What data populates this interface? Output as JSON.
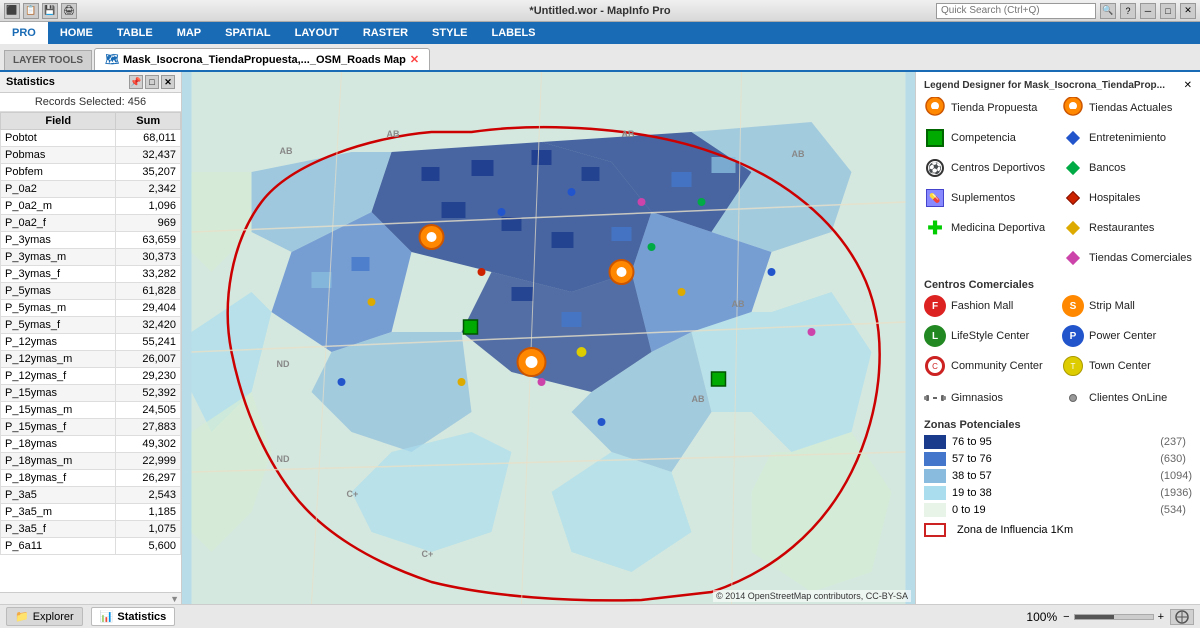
{
  "titlebar": {
    "title": "*Untitled.wor - MapInfo Pro",
    "search_placeholder": "Quick Search (Ctrl+Q)"
  },
  "menubar": {
    "items": [
      {
        "label": "PRO",
        "active": true
      },
      {
        "label": "HOME"
      },
      {
        "label": "TABLE"
      },
      {
        "label": "MAP"
      },
      {
        "label": "SPATIAL"
      },
      {
        "label": "LAYOUT"
      },
      {
        "label": "RASTER"
      },
      {
        "label": "STYLE"
      },
      {
        "label": "LABELS"
      }
    ]
  },
  "layer_tools_tab": "LAYER TOOLS",
  "map_tab": {
    "label": "Mask_Isocrona_TiendaPropuesta,..._OSM_Roads Map",
    "icon": "map-icon"
  },
  "legend_tab": {
    "title": "Legend Designer for Mask_Isocrona_TiendaProp..."
  },
  "statistics": {
    "title": "Statistics",
    "records_selected": "Records Selected: 456",
    "col_field": "Field",
    "col_sum": "Sum",
    "rows": [
      {
        "field": "Pobtot",
        "sum": "68,011"
      },
      {
        "field": "Pobmas",
        "sum": "32,437"
      },
      {
        "field": "Pobfem",
        "sum": "35,207"
      },
      {
        "field": "P_0a2",
        "sum": "2,342"
      },
      {
        "field": "P_0a2_m",
        "sum": "1,096"
      },
      {
        "field": "P_0a2_f",
        "sum": "969"
      },
      {
        "field": "P_3ymas",
        "sum": "63,659"
      },
      {
        "field": "P_3ymas_m",
        "sum": "30,373"
      },
      {
        "field": "P_3ymas_f",
        "sum": "33,282"
      },
      {
        "field": "P_5ymas",
        "sum": "61,828"
      },
      {
        "field": "P_5ymas_m",
        "sum": "29,404"
      },
      {
        "field": "P_5ymas_f",
        "sum": "32,420"
      },
      {
        "field": "P_12ymas",
        "sum": "55,241"
      },
      {
        "field": "P_12ymas_m",
        "sum": "26,007"
      },
      {
        "field": "P_12ymas_f",
        "sum": "29,230"
      },
      {
        "field": "P_15ymas",
        "sum": "52,392"
      },
      {
        "field": "P_15ymas_m",
        "sum": "24,505"
      },
      {
        "field": "P_15ymas_f",
        "sum": "27,883"
      },
      {
        "field": "P_18ymas",
        "sum": "49,302"
      },
      {
        "field": "P_18ymas_m",
        "sum": "22,999"
      },
      {
        "field": "P_18ymas_f",
        "sum": "26,297"
      },
      {
        "field": "P_3a5",
        "sum": "2,543"
      },
      {
        "field": "P_3a5_m",
        "sum": "1,185"
      },
      {
        "field": "P_3a5_f",
        "sum": "1,075"
      },
      {
        "field": "P_6a11",
        "sum": "5,600"
      }
    ]
  },
  "legend": {
    "title": "Legend Designer for Mask_Isocrona_TiendaProp...",
    "items": [
      {
        "label": "Tienda Propuesta",
        "icon": "orange-pin"
      },
      {
        "label": "Tiendas Actuales",
        "icon": "orange-pin-2"
      },
      {
        "label": "Competencia",
        "icon": "green-square"
      },
      {
        "label": "Entretenimiento",
        "icon": "diamond-blue"
      },
      {
        "label": "Centros Deportivos",
        "icon": "soccer-ball"
      },
      {
        "label": "Bancos",
        "icon": "diamond-green"
      },
      {
        "label": "Suplementos",
        "icon": "supplement"
      },
      {
        "label": "Hospitales",
        "icon": "diamond-red"
      },
      {
        "label": "Medicina Deportiva",
        "icon": "cross"
      },
      {
        "label": "Restaurantes",
        "icon": "diamond-yellow"
      },
      {
        "label": "",
        "icon": ""
      },
      {
        "label": "Tiendas Comerciales",
        "icon": "diamond-pink"
      }
    ],
    "centros_title": "Centros Comerciales",
    "centros": [
      {
        "label": "Fashion Mall",
        "icon": "cc-red"
      },
      {
        "label": "Strip Mall",
        "icon": "cc-orange"
      },
      {
        "label": "LifeStyle Center",
        "icon": "cc-green"
      },
      {
        "label": "Power Center",
        "icon": "cc-blue"
      },
      {
        "label": "Community Center",
        "icon": "cc-red-ring"
      },
      {
        "label": "Town Center",
        "icon": "cc-yellow"
      }
    ],
    "gimnasios_label": "Gimnasios",
    "clientes_label": "Clientes OnLine",
    "zonas_title": "Zonas Potenciales",
    "zonas": [
      {
        "range": "76 to 95",
        "count": "(237)",
        "color": "dark"
      },
      {
        "range": "57 to 76",
        "count": "(630)",
        "color": "med-dark"
      },
      {
        "range": "38 to 57",
        "count": "(1094)",
        "color": "med"
      },
      {
        "range": "19 to 38",
        "count": "(1936)",
        "color": "light"
      },
      {
        "range": "0 to 19",
        "count": "(534)",
        "color": "lightest"
      }
    ],
    "zona_influencia_label": "Zona de Influencia 1Km"
  },
  "statusbar": {
    "explorer_tab": "Explorer",
    "statistics_tab": "Statistics",
    "zoom": "100%"
  },
  "map_copyright": "© 2014 OpenStreetMap contributors, CC-BY-SA"
}
